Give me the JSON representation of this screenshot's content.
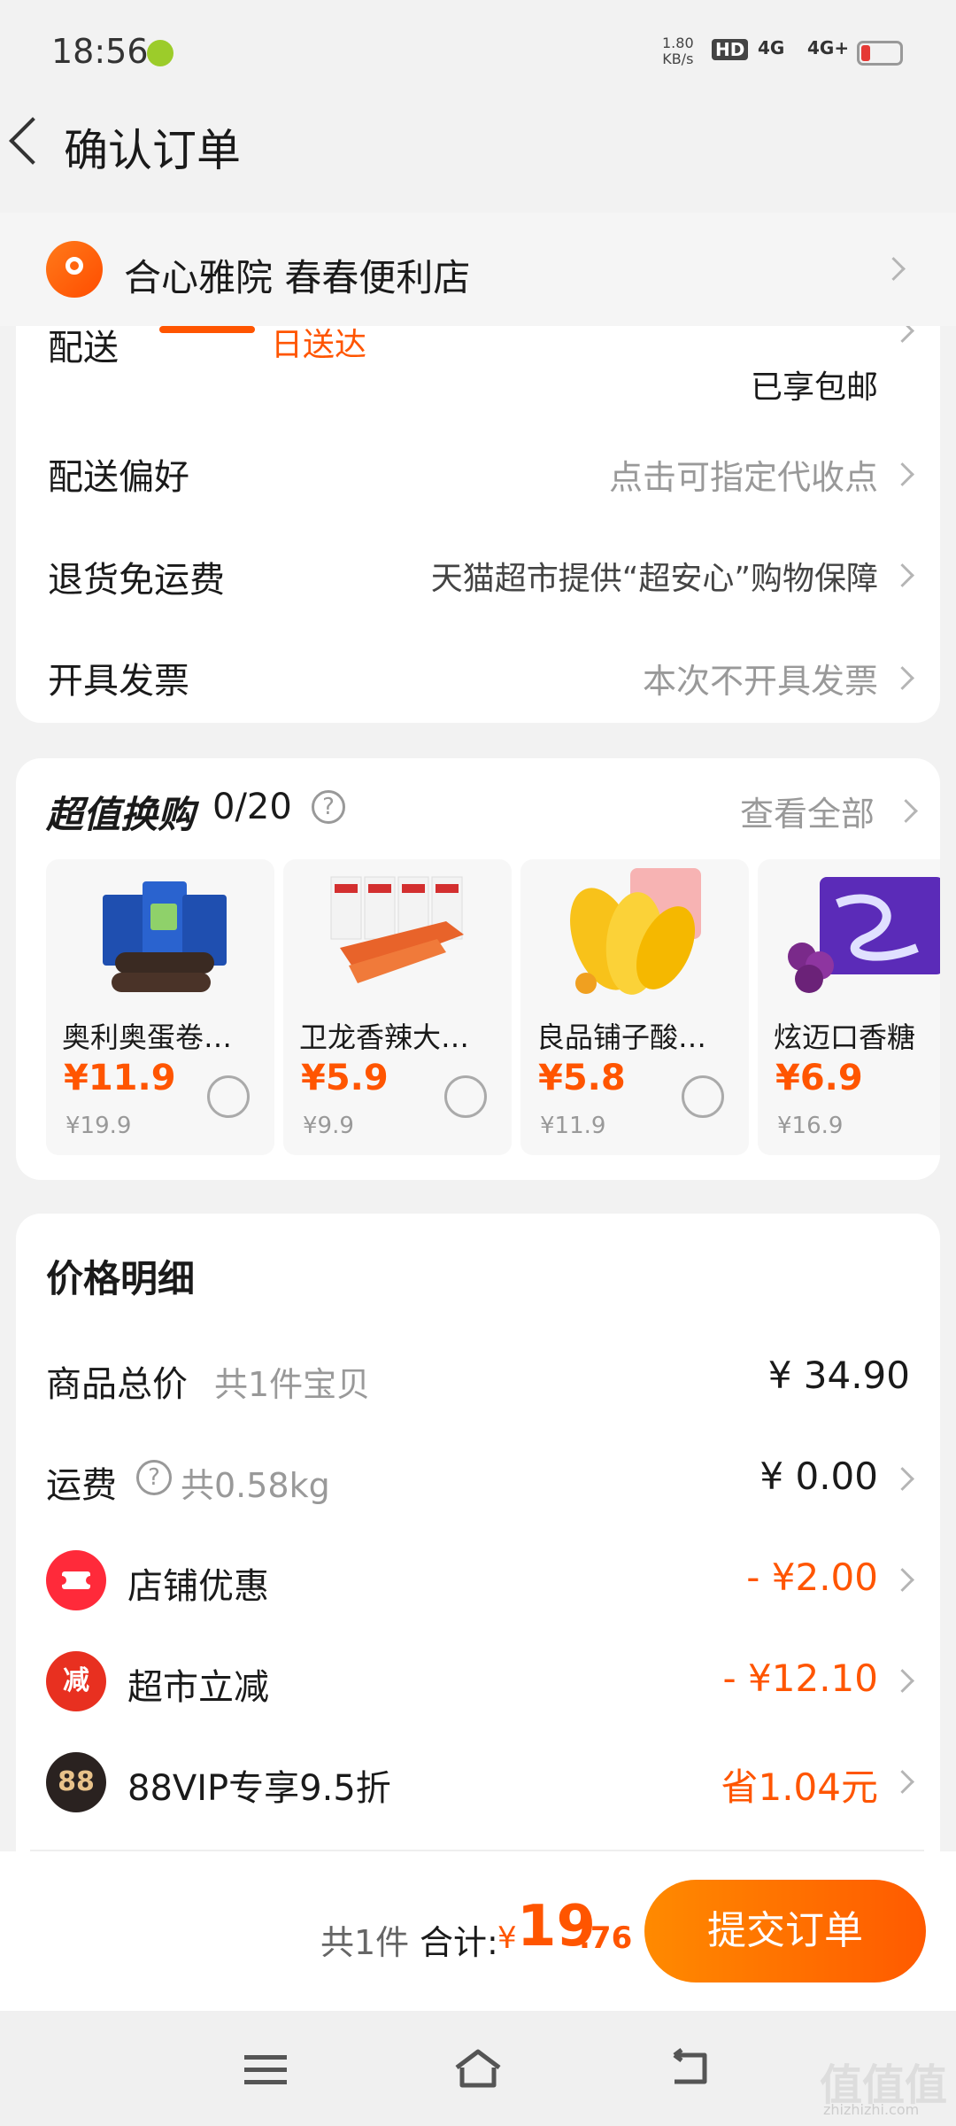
{
  "status_bar": {
    "time": "18:56",
    "net_speed_value": "1.80",
    "net_speed_unit": "KB/s",
    "hd": "HD",
    "sig1": "4G",
    "sig2": "4G+"
  },
  "header": {
    "title": "确认订单"
  },
  "address": {
    "text": "合心雅院  春春便利店"
  },
  "delivery": {
    "label": "配送",
    "value": "日送达",
    "note": "已享包邮",
    "pref_label": "配送偏好",
    "pref_value": "点击可指定代收点",
    "return_label": "退货免运费",
    "return_value": "天猫超市提供“超安心”购物保障",
    "invoice_label": "开具发票",
    "invoice_value": "本次不开具发票"
  },
  "exchange": {
    "title": "超值换购",
    "count": "0/20",
    "help": "?",
    "view_all": "查看全部",
    "products": [
      {
        "name": "奥利奥蛋卷…",
        "price": "¥11.9",
        "orig": "¥19.9"
      },
      {
        "name": "卫龙香辣大…",
        "price": "¥5.9",
        "orig": "¥9.9"
      },
      {
        "name": "良品铺子酸…",
        "price": "¥5.8",
        "orig": "¥11.9"
      },
      {
        "name": "炫迈口香糖",
        "price": "¥6.9",
        "orig": "¥16.9"
      }
    ]
  },
  "price_detail": {
    "title": "价格明细",
    "goods_label": "商品总价",
    "goods_sub": "共1件宝贝",
    "goods_value": "¥ 34.90",
    "shipping_label": "运费",
    "shipping_sub": "共0.58kg",
    "shipping_value": "¥ 0.00",
    "shop_label": "店铺优惠",
    "shop_value": "- ¥2.00",
    "market_label": "超市立减",
    "market_value": "- ¥12.10",
    "market_icon": "减",
    "vip_label": "88VIP专享9.5折",
    "vip_value": "省1.04元",
    "vip_icon": "88"
  },
  "footer": {
    "count": "共1件",
    "total_label": "合计:",
    "currency": "¥",
    "total_int": "19",
    "total_dec": ".76",
    "submit": "提交订单"
  },
  "watermark": {
    "text": "值值值",
    "sub": "zhizhizhi.com"
  },
  "colors": {
    "accent": "#ff5500",
    "background": "#f2f2f2"
  }
}
